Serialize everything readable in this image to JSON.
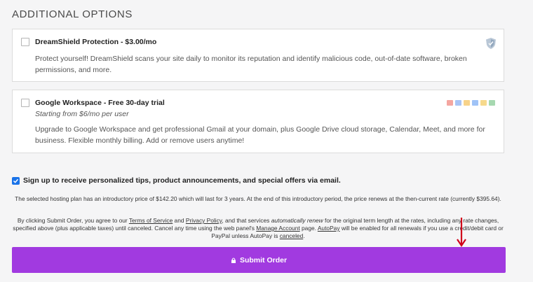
{
  "section": {
    "title": "ADDITIONAL OPTIONS"
  },
  "options": [
    {
      "title": "DreamShield Protection - $3.00/mo",
      "description": "Protect yourself! DreamShield scans your site daily to monitor its reputation and identify malicious code, out-of-date software, broken permissions, and more.",
      "checked": false,
      "icon": "shield-icon"
    },
    {
      "title": "Google Workspace - Free 30-day trial",
      "subtitle": "Starting from $6/mo per user",
      "description": "Upgrade to Google Workspace and get professional Gmail at your domain, plus Google Drive cloud storage, Calendar, Meet, and more for business. Flexible monthly billing. Add or remove users anytime!",
      "checked": false,
      "icon": "google-workspace-icons"
    }
  ],
  "newsletter": {
    "checked": true,
    "label": "Sign up to receive personalized tips, product announcements, and special offers via email."
  },
  "intro_notice": "The selected hosting plan has an introductory price of $142.20 which will last for 3 years. At the end of this introductory period, the price renews at the then-current rate (currently $395.64).",
  "terms": {
    "p1": "By clicking Submit Order, you agree to our ",
    "terms_link": "Terms of Service",
    "p2": " and ",
    "privacy_link": "Privacy Policy",
    "p3": ", and that services ",
    "auto_renew": "automatically renew",
    "p4": " for the original term length at the rates, including any rate changes, specified above (plus applicable taxes) until canceled. Cancel any time using the web panel's ",
    "manage_link": "Manage Account",
    "p5": " page. ",
    "autopay_link": "AutoPay",
    "p6": " will be enabled for all renewals if you use a credit/debit card or PayPal unless AutoPay is ",
    "canceled_link": "canceled",
    "p7": "."
  },
  "submit": {
    "label": "Submit Order"
  },
  "colors": {
    "accent": "#a13ae0",
    "checkbox": "#1a73e8",
    "annotation_arrow": "#d0021b"
  }
}
